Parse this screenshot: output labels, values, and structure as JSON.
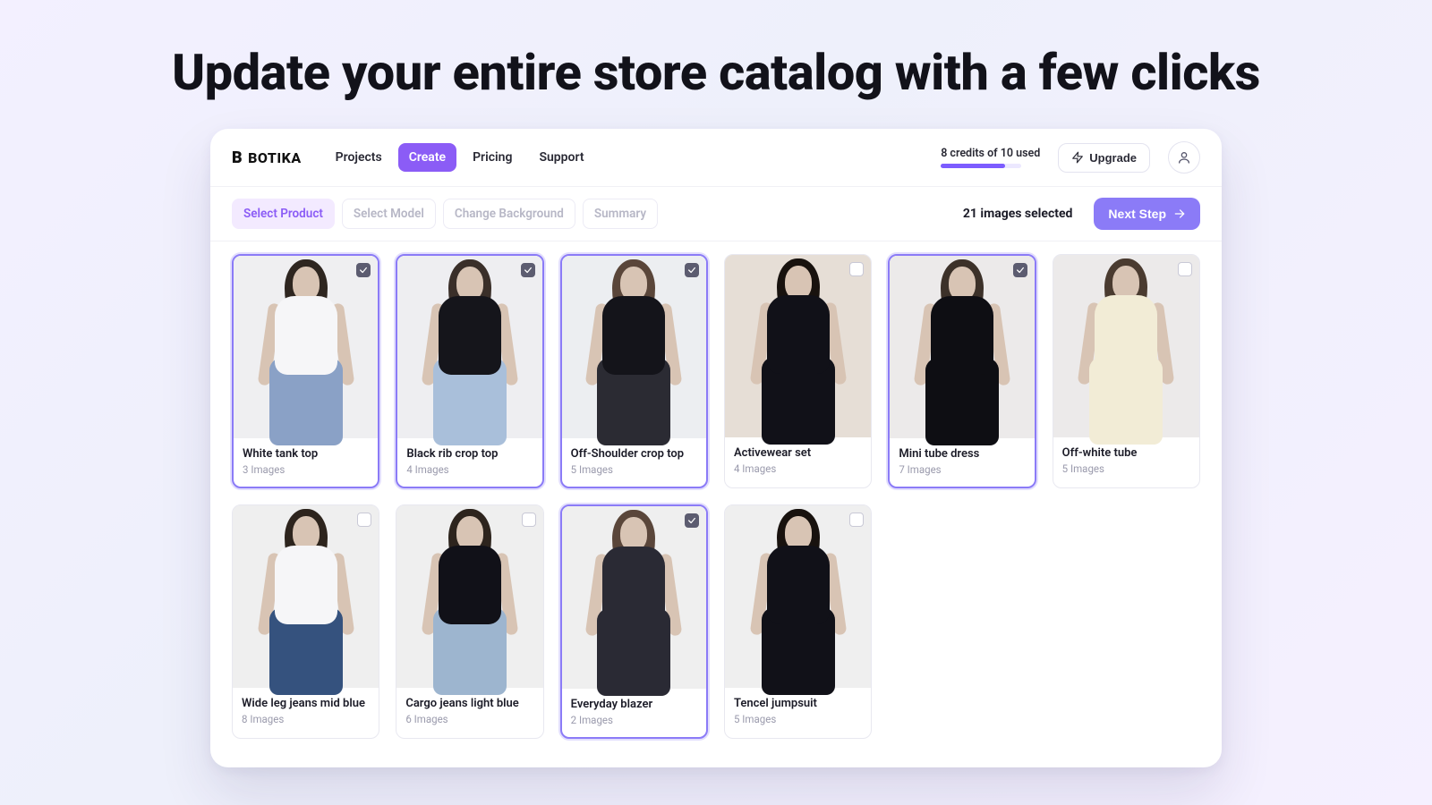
{
  "hero": "Update your entire store catalog with a few clicks",
  "brand": "BOTIKA",
  "nav": {
    "projects": "Projects",
    "create": "Create",
    "pricing": "Pricing",
    "support": "Support",
    "active": "create"
  },
  "credits": {
    "text": "8 credits of 10 used",
    "used": 8,
    "total": 10
  },
  "upgrade_label": "Upgrade",
  "steps": {
    "items": [
      {
        "id": "select-product",
        "label": "Select Product",
        "current": true
      },
      {
        "id": "select-model",
        "label": "Select Model",
        "current": false
      },
      {
        "id": "change-background",
        "label": "Change Background",
        "current": false
      },
      {
        "id": "summary",
        "label": "Summary",
        "current": false
      }
    ]
  },
  "selection_text": "21 images selected",
  "next_label": "Next Step",
  "products": [
    {
      "name": "White tank top",
      "count": "3 Images",
      "selected": true,
      "look": {
        "bg": "#efeff1",
        "top": "#f6f6f8",
        "bottom": "#8aa1c6",
        "hair": "#2e2620"
      }
    },
    {
      "name": "Black rib crop top",
      "count": "4 Images",
      "selected": true,
      "look": {
        "bg": "#eeeef1",
        "top": "#15151b",
        "bottom": "#a9bfda",
        "hair": "#3a2f29"
      }
    },
    {
      "name": "Off-Shoulder crop top",
      "count": "5 Images",
      "selected": true,
      "look": {
        "bg": "#eceef1",
        "top": "#14141a",
        "bottom": "#2b2b33",
        "hair": "#5a463a"
      }
    },
    {
      "name": "Activewear set",
      "count": "4 Images",
      "selected": false,
      "look": {
        "bg": "#e6ded6",
        "top": "#111118",
        "bottom": "#111118",
        "hair": "#18120e"
      }
    },
    {
      "name": "Mini tube dress",
      "count": "7 Images",
      "selected": true,
      "look": {
        "bg": "#eceaea",
        "top": "#0e0e13",
        "bottom": "#0e0e13",
        "hair": "#3c3129"
      }
    },
    {
      "name": "Off-white tube",
      "count": "5 Images",
      "selected": false,
      "look": {
        "bg": "#eceaea",
        "top": "#f2ecd6",
        "bottom": "#f2ecd6",
        "hair": "#4a3b30"
      }
    },
    {
      "name": "Wide leg jeans mid blue",
      "count": "8 Images",
      "selected": false,
      "look": {
        "bg": "#efefef",
        "top": "#f6f6f8",
        "bottom": "#35527e",
        "hair": "#2d241d"
      }
    },
    {
      "name": "Cargo jeans light blue",
      "count": "6 Images",
      "selected": false,
      "look": {
        "bg": "#efefef",
        "top": "#111118",
        "bottom": "#9db5cf",
        "hair": "#2d241d"
      }
    },
    {
      "name": "Everyday blazer",
      "count": "2 Images",
      "selected": true,
      "look": {
        "bg": "#efefef",
        "top": "#2a2a34",
        "bottom": "#2a2a34",
        "hair": "#5a463a"
      }
    },
    {
      "name": "Tencel jumpsuit",
      "count": "5 Images",
      "selected": false,
      "look": {
        "bg": "#efefef",
        "top": "#111118",
        "bottom": "#111118",
        "hair": "#18120e"
      }
    }
  ]
}
